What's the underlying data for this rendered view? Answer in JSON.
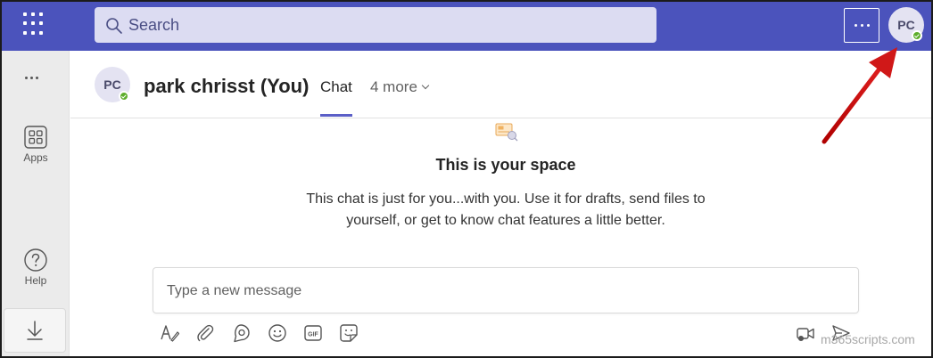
{
  "topbar": {
    "search_placeholder": "Search",
    "user_initials": "PC",
    "presence": "available"
  },
  "rail": {
    "apps_label": "Apps",
    "help_label": "Help"
  },
  "chat_header": {
    "avatar_initials": "PC",
    "name": "park chrisst (You)",
    "tabs": [
      {
        "label": "Chat",
        "active": true
      },
      {
        "label": "4 more",
        "active": false
      }
    ]
  },
  "main": {
    "title": "This is your space",
    "description_line1": "This chat is just for you...with you. Use it for drafts, send files to",
    "description_line2": "yourself, or get to know chat features a little better."
  },
  "composer": {
    "placeholder": "Type a new message",
    "tools": [
      "format-icon",
      "attach-icon",
      "loop-icon",
      "emoji-icon",
      "gif-icon",
      "sticker-icon",
      "meet-now-icon",
      "send-icon"
    ]
  },
  "watermark": "m365scripts.com",
  "colors": {
    "brand": "#4b53bc",
    "search_bg": "#dcdcf2",
    "presence": "#5dae2c",
    "tab_underline": "#5b5fc7",
    "annotation_arrow": "#d01818"
  }
}
